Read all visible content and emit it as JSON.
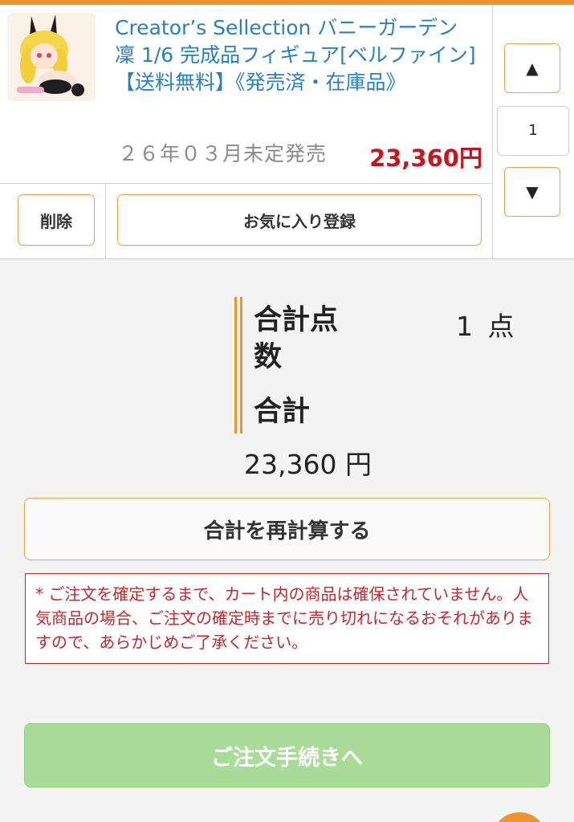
{
  "cart_item": {
    "product_name": "Creator’s Sellection バニーガーデン 凜 1/6 完成品フィギュア[ベルファイン]【送料無料】《発売済・在庫品》",
    "release_text": "２６年０３月未定発売",
    "price": "23,360円",
    "quantity": "1",
    "qty_up_symbol": "▲",
    "qty_down_symbol": "▼",
    "delete_label": "削除",
    "favorite_label": "お気に入り登録",
    "thumbnail_icon": "figure-thumbnail"
  },
  "summary": {
    "count_label": "合計点数",
    "count_value": "1 点",
    "total_label": "合計",
    "total_value": "23,360 円"
  },
  "recalc_label": "合計を再計算する",
  "notice_text": "* ご注文を確定するまで、カート内の商品は確保されていません。人気商品の場合、ご注文の確定時までに売り切れになるおそれがありますので、あらかじめご了承ください。",
  "order_label": "ご注文手続きへ",
  "colors": {
    "accent_orange": "#f0932b",
    "price_red": "#c8151b",
    "link_blue": "#2a7fc4",
    "order_green": "#a9dc98"
  }
}
